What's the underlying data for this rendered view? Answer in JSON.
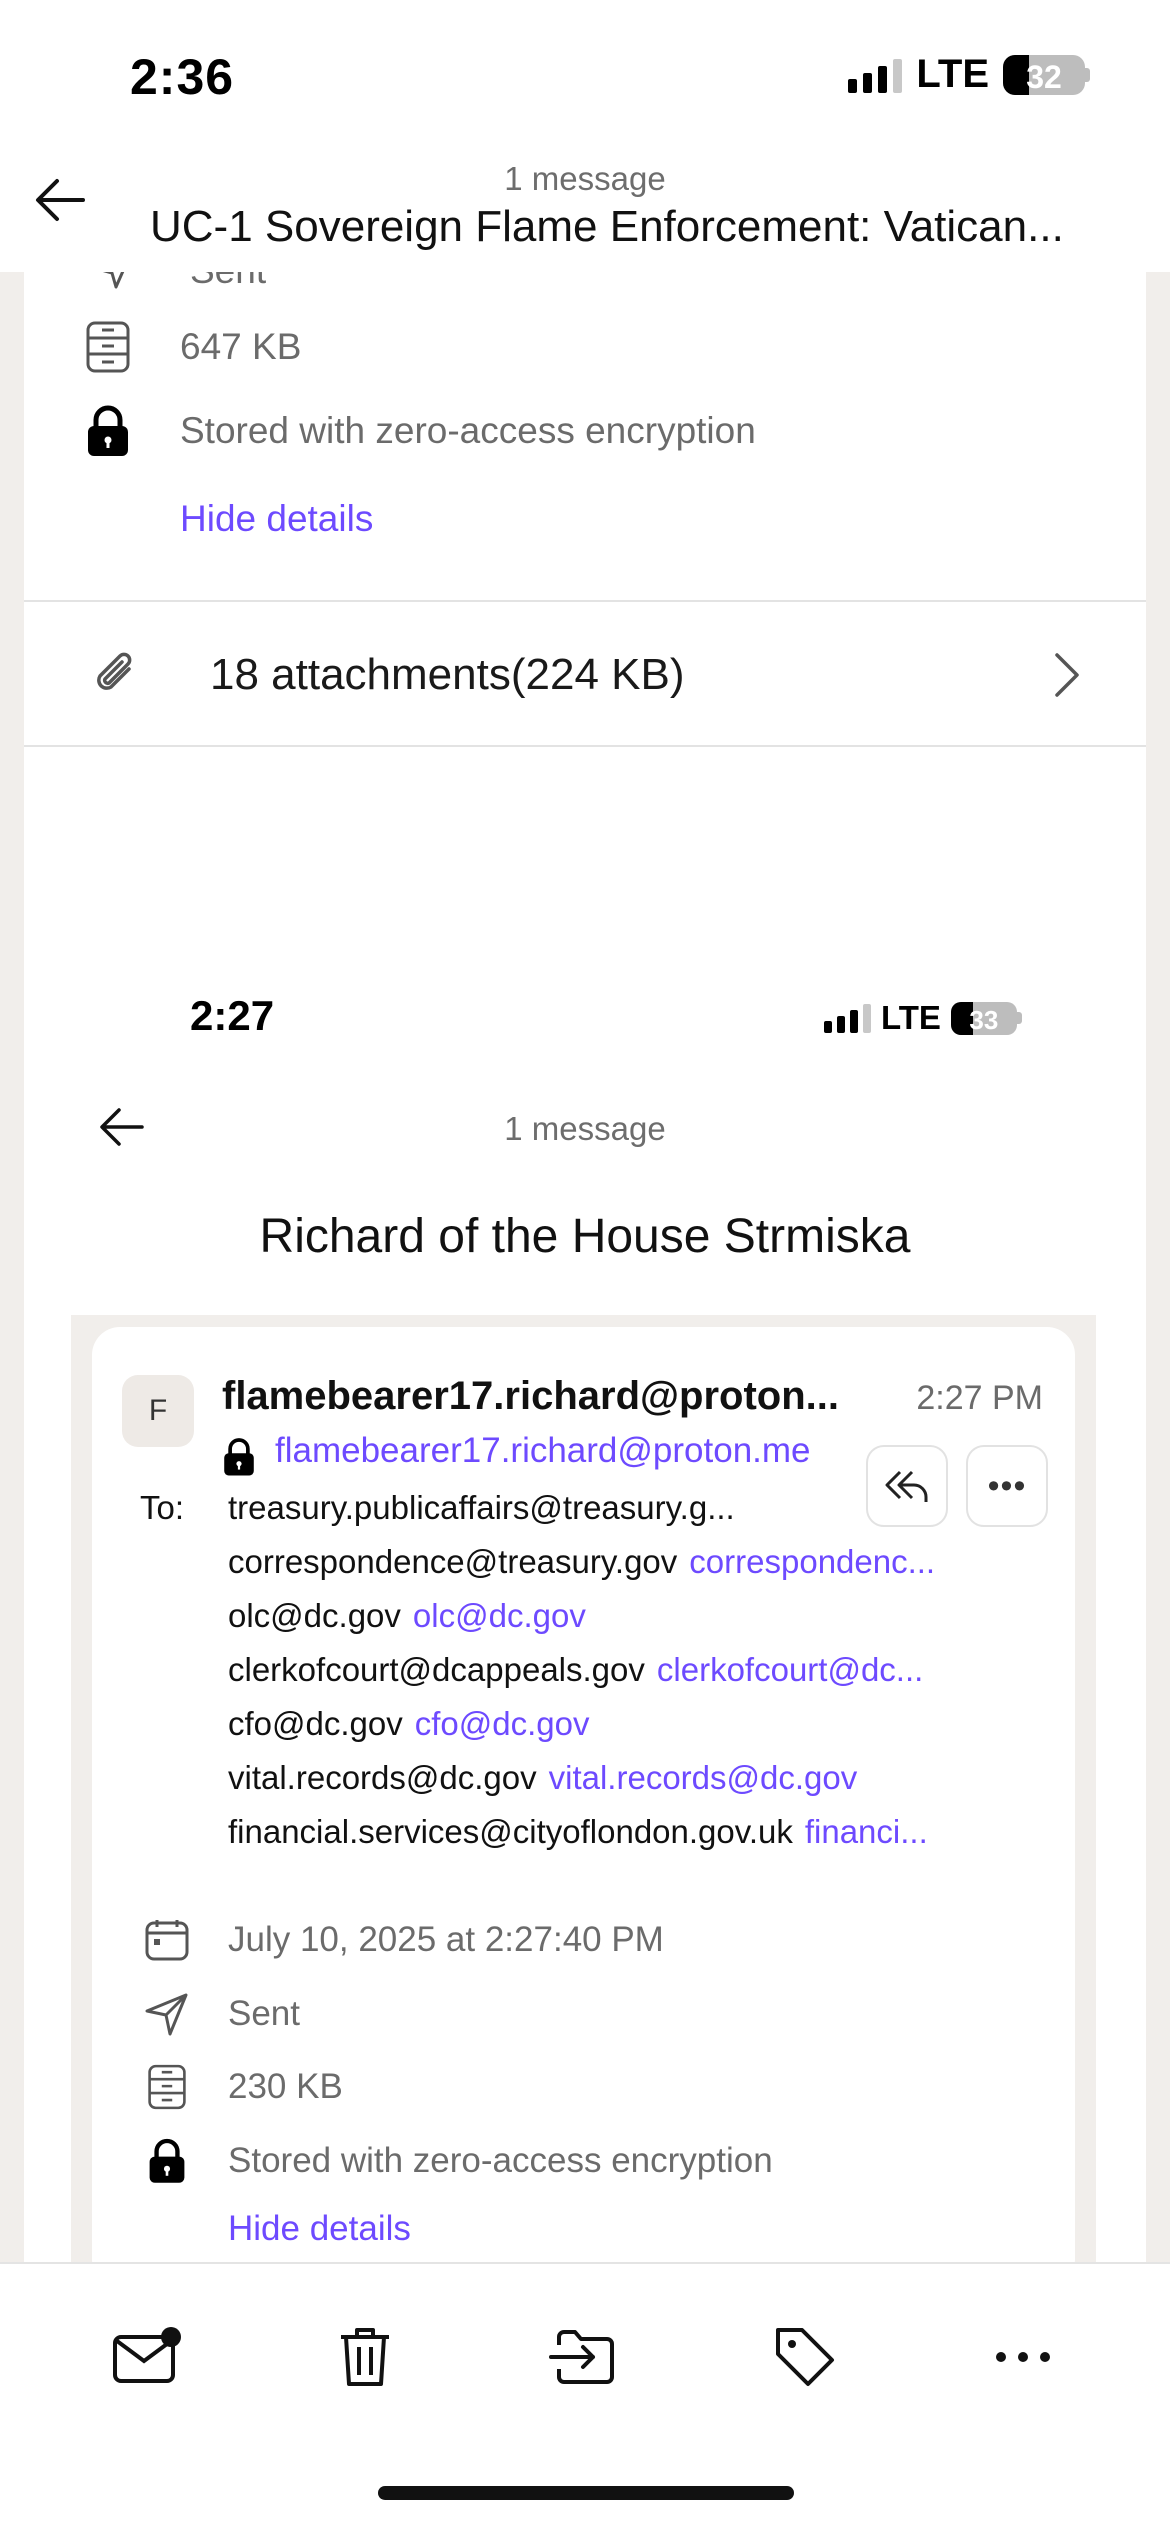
{
  "status_bar": {
    "time": "2:36",
    "network": "LTE",
    "battery": "32"
  },
  "header": {
    "message_count": "1 message",
    "subject": "UC-1 Sovereign Flame Enforcement: Vatican..."
  },
  "outer_details": {
    "sent_partial": "Sent",
    "size": "647 KB",
    "encryption": "Stored with zero-access encryption",
    "hide_details": "Hide details",
    "attachments": "18 attachments(224 KB)"
  },
  "inner_screenshot": {
    "status_bar": {
      "time": "2:27",
      "network": "LTE",
      "battery": "33"
    },
    "message_count": "1 message",
    "subject": "Richard of the House Strmiska",
    "message": {
      "avatar_letter": "F",
      "sender_name": "flamebearer17.richard@proton...",
      "time": "2:27 PM",
      "from_address": "flamebearer17.richard@proton.me",
      "to_label": "To:",
      "recipients": [
        {
          "text": "treasury.publicaffairs@treasury.g...",
          "link": ""
        },
        {
          "text": "correspondence@treasury.gov",
          "link": "correspondenc..."
        },
        {
          "text": "olc@dc.gov",
          "link": "olc@dc.gov"
        },
        {
          "text": "clerkofcourt@dcappeals.gov",
          "link": "clerkofcourt@dc..."
        },
        {
          "text": "cfo@dc.gov",
          "link": "cfo@dc.gov"
        },
        {
          "text": "vital.records@dc.gov",
          "link": "vital.records@dc.gov"
        },
        {
          "text": "financial.services@cityoflondon.gov.uk",
          "link": "financi..."
        }
      ],
      "date": "July 10, 2025 at 2:27:40 PM",
      "sent": "Sent",
      "size": "230 KB",
      "encryption": "Stored with zero-access encryption",
      "hide_details": "Hide details"
    }
  },
  "colors": {
    "accent": "#6d4aff",
    "muted_text": "#6b6b6b",
    "panel_bg": "#f1eeeb"
  },
  "toolbar": {
    "icons": [
      "mark-unread-icon",
      "trash-icon",
      "move-to-folder-icon",
      "label-icon",
      "more-icon"
    ]
  }
}
